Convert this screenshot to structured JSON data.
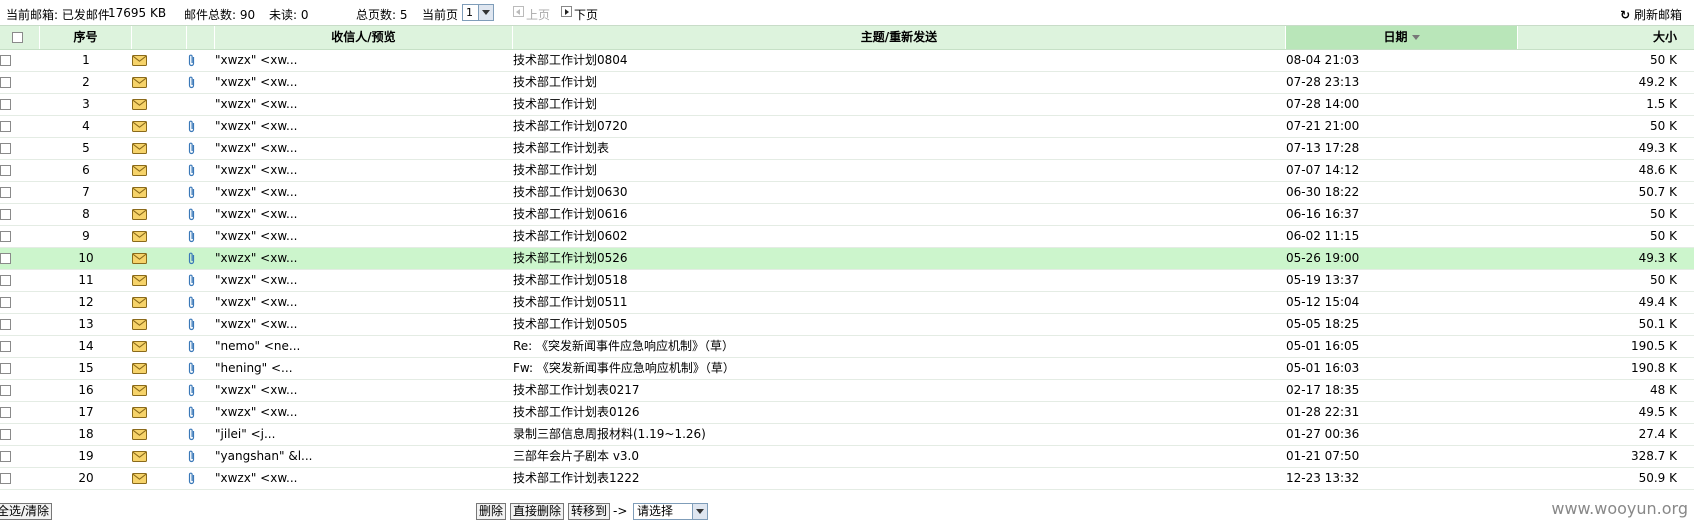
{
  "topbar": {
    "current_mailbox": "当前邮箱: 已发邮件",
    "size": "17695 KB",
    "total": "邮件总数: 90",
    "unread": "未读: 0",
    "total_pages": "总页数: 5",
    "current_page_label": "当前页",
    "current_page_value": "1",
    "prev_label": "上页",
    "next_label": "下页",
    "refresh_label": "刷新邮箱"
  },
  "table": {
    "headers": {
      "index": "序号",
      "recipient": "收信人/预览",
      "subject": "主题/重新发送",
      "date": "日期",
      "size": "大小"
    },
    "rows": [
      {
        "no": "1",
        "to": "\"xwzx\" <xw...",
        "subject": "技术部工作计划0804",
        "date": "08-04 21:03",
        "size": "50 K",
        "attach": true
      },
      {
        "no": "2",
        "to": "\"xwzx\" <xw...",
        "subject": "技术部工作计划",
        "date": "07-28 23:13",
        "size": "49.2 K",
        "attach": true
      },
      {
        "no": "3",
        "to": "\"xwzx\" <xw...",
        "subject": "技术部工作计划",
        "date": "07-28 14:00",
        "size": "1.5 K",
        "attach": false
      },
      {
        "no": "4",
        "to": "\"xwzx\" <xw...",
        "subject": "技术部工作计划0720",
        "date": "07-21 21:00",
        "size": "50 K",
        "attach": true
      },
      {
        "no": "5",
        "to": "\"xwzx\" <xw...",
        "subject": "技术部工作计划表",
        "date": "07-13 17:28",
        "size": "49.3 K",
        "attach": true
      },
      {
        "no": "6",
        "to": "\"xwzx\" <xw...",
        "subject": "技术部工作计划",
        "date": "07-07 14:12",
        "size": "48.6 K",
        "attach": true
      },
      {
        "no": "7",
        "to": "\"xwzx\" <xw...",
        "subject": "技术部工作计划0630",
        "date": "06-30 18:22",
        "size": "50.7 K",
        "attach": true
      },
      {
        "no": "8",
        "to": "\"xwzx\" <xw...",
        "subject": "技术部工作计划0616",
        "date": "06-16 16:37",
        "size": "50 K",
        "attach": true
      },
      {
        "no": "9",
        "to": "\"xwzx\" <xw...",
        "subject": "技术部工作计划0602",
        "date": "06-02 11:15",
        "size": "50 K",
        "attach": true
      },
      {
        "no": "10",
        "to": "\"xwzx\" <xw...",
        "subject": "技术部工作计划0526",
        "date": "05-26 19:00",
        "size": "49.3 K",
        "attach": true
      },
      {
        "no": "11",
        "to": "\"xwzx\" <xw...",
        "subject": "技术部工作计划0518",
        "date": "05-19 13:37",
        "size": "50 K",
        "attach": true
      },
      {
        "no": "12",
        "to": "\"xwzx\" <xw...",
        "subject": "技术部工作计划0511",
        "date": "05-12 15:04",
        "size": "49.4 K",
        "attach": true
      },
      {
        "no": "13",
        "to": "\"xwzx\" <xw...",
        "subject": "技术部工作计划0505",
        "date": "05-05 18:25",
        "size": "50.1 K",
        "attach": true
      },
      {
        "no": "14",
        "to": "\"nemo\" <ne...",
        "subject": "Re: 《突发新闻事件应急响应机制》（草）",
        "date": "05-01 16:05",
        "size": "190.5 K",
        "attach": true
      },
      {
        "no": "15",
        "to": "\"hening\" <...",
        "subject": "Fw: 《突发新闻事件应急响应机制》（草）",
        "date": "05-01 16:03",
        "size": "190.8 K",
        "attach": true
      },
      {
        "no": "16",
        "to": "\"xwzx\" <xw...",
        "subject": "技术部工作计划表0217",
        "date": "02-17 18:35",
        "size": "48 K",
        "attach": true
      },
      {
        "no": "17",
        "to": "\"xwzx\" <xw...",
        "subject": "技术部工作计划表0126",
        "date": "01-28 22:31",
        "size": "49.5 K",
        "attach": true
      },
      {
        "no": "18",
        "to": "\"jilei\" <j...",
        "subject": "录制三部信息周报材料(1.19~1.26)",
        "date": "01-27 00:36",
        "size": "27.4 K",
        "attach": true
      },
      {
        "no": "19",
        "to": "\"yangshan\" &l...",
        "subject": "三部年会片子剧本 v3.0",
        "date": "01-21 07:50",
        "size": "328.7 K",
        "attach": true
      },
      {
        "no": "20",
        "to": "\"xwzx\" <xw...",
        "subject": "技术部工作计划表1222",
        "date": "12-23 13:32",
        "size": "50.9 K",
        "attach": true
      }
    ]
  },
  "bottom": {
    "select_all": "全选/清除",
    "delete": "删除",
    "delete_direct": "直接删除",
    "move_to": "转移到",
    "arrow": "->",
    "choose": "请选择"
  },
  "watermark": "www.wooyun.org",
  "colors": {
    "header_bg": "#ddf3dd",
    "sorted_header_bg": "#b9e6b9",
    "highlight_row": "#ccf5cc"
  }
}
